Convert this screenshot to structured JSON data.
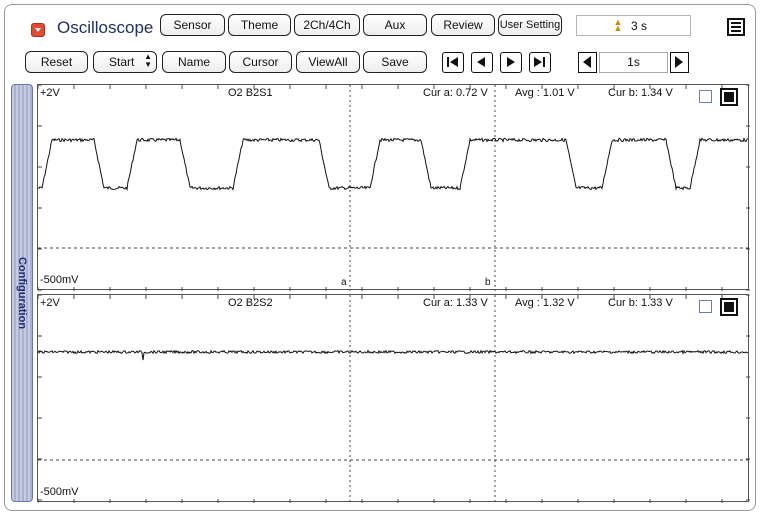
{
  "app": {
    "title": "Oscilloscope"
  },
  "top_buttons": [
    "Sensor",
    "Theme",
    "2Ch/4Ch",
    "Aux",
    "Review",
    "User Setting"
  ],
  "timer": {
    "value": "3 s",
    "icon": "stopwatch-icon"
  },
  "toolbar": {
    "reset": "Reset",
    "start": "Start",
    "name": "Name",
    "cursor": "Cursor",
    "viewall": "ViewAll",
    "save": "Save"
  },
  "nav_icons": [
    "skip-to-start-icon",
    "step-back-icon",
    "step-forward-icon",
    "skip-to-end-icon"
  ],
  "time_scale": {
    "value": "1s"
  },
  "sidebar": {
    "label": "Configuration"
  },
  "channels": [
    {
      "name": "O2 B2S1",
      "y_top": "+2V",
      "y_bottom": "-500mV",
      "cur_a": "Cur a: 0.72 V",
      "avg": "Avg  : 1.01 V",
      "cur_b": "Cur b: 1.34 V",
      "cursor_a_label": "a",
      "cursor_b_label": "b"
    },
    {
      "name": "O2 B2S2",
      "y_top": "+2V",
      "y_bottom": "-500mV",
      "cur_a": "Cur a: 1.33 V",
      "avg": "Avg  : 1.32 V",
      "cur_b": "Cur b: 1.33 V"
    }
  ],
  "colors": {
    "title": "#1d2f5a",
    "sidebar": "#aab2d2",
    "app_icon": "#e24a33",
    "trace": "#111111"
  }
}
